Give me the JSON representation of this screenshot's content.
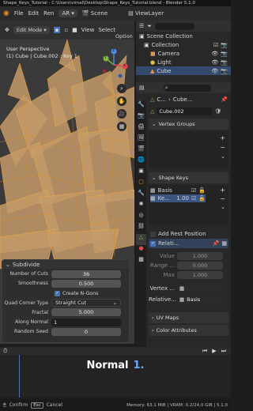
{
  "window": {
    "title": "Shape_Keys_Tutorial - C:\\Users\\vimal\\Desktop\\Shape_Keys_Tutorial.blend - Blender 5.1.0"
  },
  "menu": {
    "file": "File",
    "edit": "Edit",
    "render": "Ren",
    "workspace": "AR",
    "scene": "Scene",
    "view_layer": "ViewLayer"
  },
  "viewport_header": {
    "mode": "Edit Mode",
    "view": "View",
    "select": "Select",
    "options": "Option"
  },
  "viewport": {
    "perspective": "User Perspective",
    "object_info": "(1) Cube | Cube.002 : Key 1",
    "nav_x": "X",
    "nav_y": "Y",
    "nav_z": "Z"
  },
  "outliner": {
    "items": [
      {
        "label": "Scene Collection"
      },
      {
        "label": "Collection"
      },
      {
        "label": "Camera"
      },
      {
        "label": "Light"
      },
      {
        "label": "Cube"
      }
    ]
  },
  "properties": {
    "search_placeholder": "",
    "breadcrumb_a": "C...",
    "breadcrumb_b": "Cube...",
    "mesh_name": "Cube.002",
    "vertex_groups": "Vertex Groups",
    "shape_keys": "Shape Keys",
    "shape_key_items": [
      {
        "name": "Basis",
        "value": ""
      },
      {
        "name": "Ke...",
        "value": "1.00"
      }
    ],
    "add_rest_position": "Add Rest Position",
    "relative": "Relati...",
    "value_label": "Value",
    "value": "1.000",
    "range_label": "Range ...",
    "range": "0.000",
    "max_label": "Max",
    "max": "1.000",
    "vertex_group_label": "Vertex ...",
    "relative_to_label": "Relative...",
    "relative_to": "Basis",
    "uv_maps": "UV Maps",
    "color_attributes": "Color Attributes"
  },
  "operator_panel": {
    "title": "Subdivide",
    "number_of_cuts_label": "Number of Cuts",
    "number_of_cuts": "36",
    "smoothness_label": "Smoothness",
    "smoothness": "0.500",
    "create_ngons": "Create N-Gons",
    "quad_corner_label": "Quad Corner Type",
    "quad_corner": "Straight Cut",
    "fractal_label": "Fractal",
    "fractal": "5.000",
    "along_normal_label": "Along Normal",
    "along_normal": "1",
    "random_seed_label": "Random Seed",
    "random_seed": "0"
  },
  "overlay": {
    "word": "Normal",
    "value": "1."
  },
  "statusbar": {
    "confirm": "Confirm",
    "esc": "Esc",
    "cancel": "Cancel",
    "memory": "Memory: 63.1 MiB | VRAM: 0.2/24.0 GiB | 5.1.0"
  },
  "colors": {
    "accent": "#4772b3",
    "selection": "#e8a23a",
    "mesh_face": "#c9a070",
    "overlay_value": "#6fa8ff"
  }
}
